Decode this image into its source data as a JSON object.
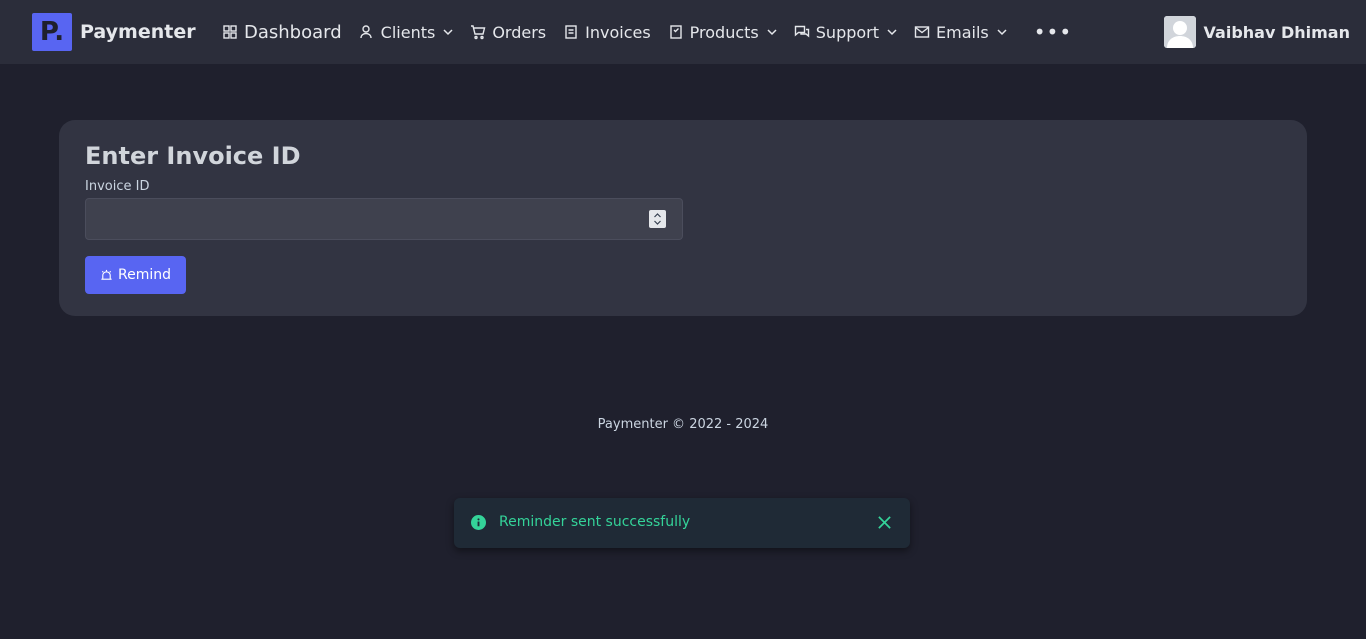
{
  "brand": {
    "logo_letter": "P.",
    "name": "Paymenter",
    "color": "#5865f2"
  },
  "nav": {
    "dashboard": "Dashboard",
    "clients": "Clients",
    "orders": "Orders",
    "invoices": "Invoices",
    "products": "Products",
    "support": "Support",
    "emails": "Emails",
    "more": "•••"
  },
  "user": {
    "name": "Vaibhav Dhiman"
  },
  "form": {
    "title": "Enter Invoice ID",
    "field_label": "Invoice ID",
    "input_value": "",
    "button_label": "Remind"
  },
  "footer": {
    "text": "Paymenter © 2022 - 2024"
  },
  "toast": {
    "message": "Reminder sent successfully",
    "color": "#34d399"
  }
}
